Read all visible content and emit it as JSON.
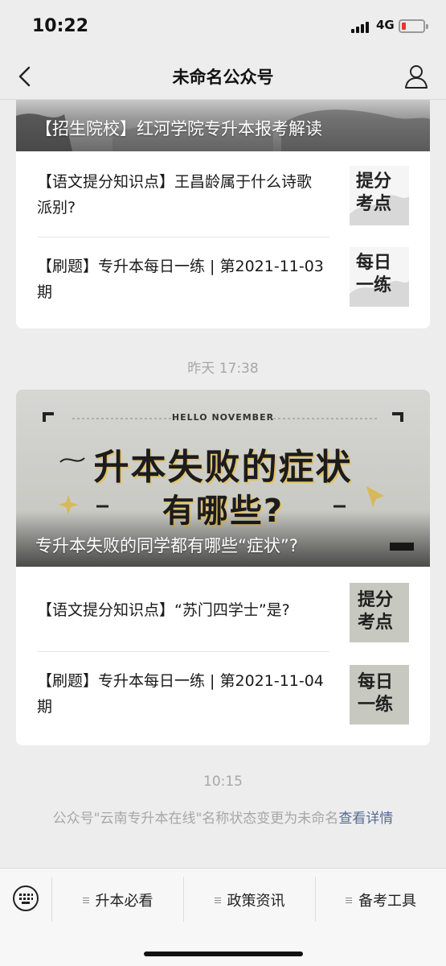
{
  "status": {
    "time": "10:22",
    "network": "4G"
  },
  "nav": {
    "title": "未命名公众号"
  },
  "messages": [
    {
      "cover_title": "【招生院校】红河学院专升本报考解读",
      "articles": [
        {
          "title": "【语文提分知识点】王昌龄属于什么诗歌派别?",
          "thumb_text": [
            "提分",
            "考点"
          ]
        },
        {
          "title": "【刷题】专升本每日一练 | 第2021-11-03期",
          "thumb_text": [
            "每日",
            "一练"
          ]
        }
      ]
    },
    {
      "timestamp": "昨天 17:38",
      "cover_banner": "HELLO NOVEMBER",
      "cover_headline_1": "升本失败的症状",
      "cover_headline_2": "有哪些?",
      "cover_title": "专升本失败的同学都有哪些“症状”?",
      "articles": [
        {
          "title": "【语文提分知识点】“苏门四学士”是?",
          "thumb_text": [
            "提分",
            "考点"
          ]
        },
        {
          "title": "【刷题】专升本每日一练 | 第2021-11-04期",
          "thumb_text": [
            "每日",
            "一练"
          ]
        }
      ]
    }
  ],
  "system_notice": {
    "timestamp": "10:15",
    "text": "公众号\"云南专升本在线\"名称状态变更为未命名",
    "link": "查看详情"
  },
  "menu": {
    "items": [
      "升本必看",
      "政策资讯",
      "备考工具"
    ]
  },
  "colors": {
    "link": "#576b95",
    "background": "#ededed",
    "card": "#ffffff"
  },
  "icons": {
    "back": "chevron-left-icon",
    "profile": "person-icon",
    "keyboard": "keyboard-icon"
  }
}
